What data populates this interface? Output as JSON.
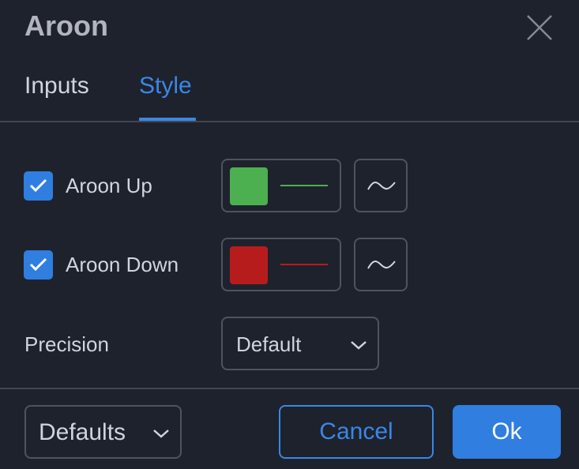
{
  "dialog": {
    "title": "Aroon"
  },
  "tabs": [
    {
      "label": "Inputs",
      "active": false
    },
    {
      "label": "Style",
      "active": true
    }
  ],
  "rows": [
    {
      "label": "Aroon Up",
      "checked": true,
      "color": "#4caf50",
      "icon": "wave-icon"
    },
    {
      "label": "Aroon Down",
      "checked": true,
      "color": "#b71c1c",
      "icon": "wave-icon"
    }
  ],
  "precision": {
    "label": "Precision",
    "value": "Default"
  },
  "footer": {
    "defaults_label": "Defaults",
    "cancel_label": "Cancel",
    "ok_label": "Ok"
  },
  "colors": {
    "background": "#1e222d",
    "accent": "#2f7ee0",
    "border": "#50535e"
  }
}
